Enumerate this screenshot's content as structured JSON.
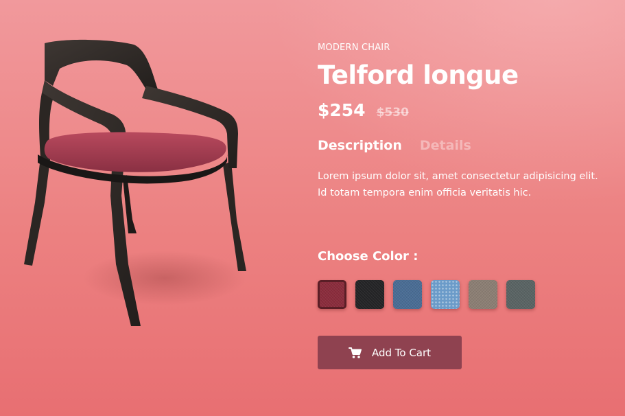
{
  "product": {
    "category": "MODERN CHAIR",
    "name": "Telford longue",
    "price": "$254",
    "old_price": "$530"
  },
  "tabs": [
    {
      "label": "Description",
      "active": true
    },
    {
      "label": "Details",
      "active": false
    }
  ],
  "description": "Lorem ipsum dolor sit, amet consectetur adipisicing elit. Id totam tempora enim officia veritatis hic.",
  "color_picker": {
    "label": "Choose Color :",
    "swatches": [
      {
        "name": "burgundy",
        "color": "#8b2c3c",
        "selected": true
      },
      {
        "name": "black",
        "color": "#242426",
        "selected": false
      },
      {
        "name": "denim-blue",
        "color": "#4a6d95",
        "selected": false
      },
      {
        "name": "sky-blue-dotted",
        "color": "#6b9bc9",
        "selected": false
      },
      {
        "name": "taupe",
        "color": "#8c7f74",
        "selected": false
      },
      {
        "name": "slate-grey",
        "color": "#5a6464",
        "selected": false
      }
    ]
  },
  "cart_button": {
    "label": "Add To Cart",
    "icon": "cart-icon"
  },
  "colors": {
    "background_top": "#f1999c",
    "background_bottom": "#e86f72",
    "button": "#8f4250",
    "chair_frame": "#2e2926",
    "chair_seat": "#a84055"
  }
}
